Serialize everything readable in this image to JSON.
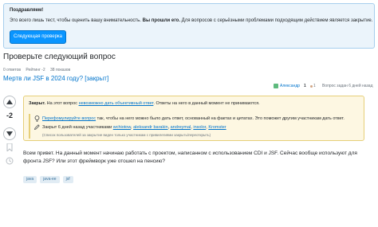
{
  "congrats": {
    "title": "Поздравляем!",
    "text_before": "Это всего лишь тест, чтобы оценить вашу внимательность.",
    "text_bold": "Вы прошли его.",
    "text_after": "Для вопросов с серьёзными проблемами подходящим действием является закрытие.",
    "button_label": "Следующая проверка"
  },
  "heading": "Проверьте следующий вопрос",
  "stats": {
    "answers": "0 ответов",
    "rating": "Рейтинг -2",
    "views": "38 показов"
  },
  "question": {
    "title": "Мертв ли JSF в 2024 году? [закрыт]",
    "author": "Александр",
    "reputation": "1",
    "badges": "1",
    "asked": "Вопрос задан 6 дней назад",
    "votes": "-2",
    "body": "Всем привет. На данный момент начинаю работать с проектом, написанном с использованием CDI и JSF. Сейчас вообще используют для фронта JSF? Или этот фреймворк уже отошел на пенсию?",
    "tags": [
      "java",
      "java-ee",
      "jsf"
    ]
  },
  "closed": {
    "label": "Закрыт.",
    "text1": "На этот вопрос",
    "link": "невозможно дать объективный ответ",
    "text2": ". Ответы на него в данный момент не принимаются.",
    "improve_link": "Перефомулируйте вопрос",
    "improve_text": "так, чтобы на него можно было дать ответ, основанный на фактах и цитатах. Это поможет другим участникам дать ответ.",
    "closed_by": "Закрыт 6 дней назад участниками",
    "closers": [
      "wchiotow",
      "aleksandr barakin",
      "andreymal",
      "insolor",
      "Kromster"
    ],
    "footnote": "(Список пользователей за закрытие виден только участникам с привилегиями закрыть/переоткрыть)"
  },
  "colors": {
    "accent": "#0a95ff",
    "link": "#0074cc",
    "notice_bg": "#fdf7e2",
    "info_bg": "#ebf4fb"
  },
  "icons": [
    "arrow-up-icon",
    "arrow-down-icon",
    "bookmark-icon",
    "history-icon",
    "lightbulb-icon",
    "pencil-icon",
    "user-avatar"
  ]
}
